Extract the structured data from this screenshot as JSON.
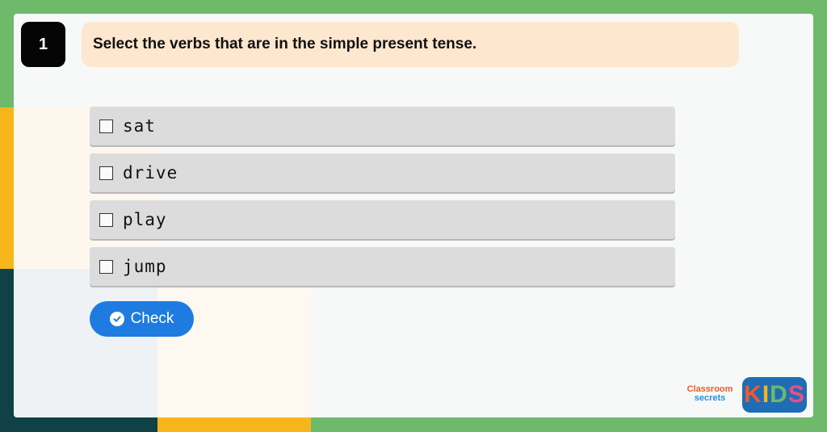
{
  "question": {
    "number": "1",
    "prompt": "Select the verbs that are in the simple present tense."
  },
  "options": [
    {
      "label": "sat",
      "checked": false
    },
    {
      "label": "drive",
      "checked": false
    },
    {
      "label": "play",
      "checked": false
    },
    {
      "label": "jump",
      "checked": false
    }
  ],
  "check_button": {
    "label": "Check",
    "icon": "check-circle-icon"
  },
  "branding": {
    "logo_line1": "Classroom",
    "logo_line2": "secrets",
    "kids_letters": [
      "K",
      "I",
      "D",
      "S"
    ]
  },
  "colors": {
    "background_green": "#6fb96a",
    "accent_yellow": "#f7b51c",
    "accent_teal": "#0f4146",
    "button_blue": "#1e7ce0",
    "question_bg": "#fde7cf"
  }
}
